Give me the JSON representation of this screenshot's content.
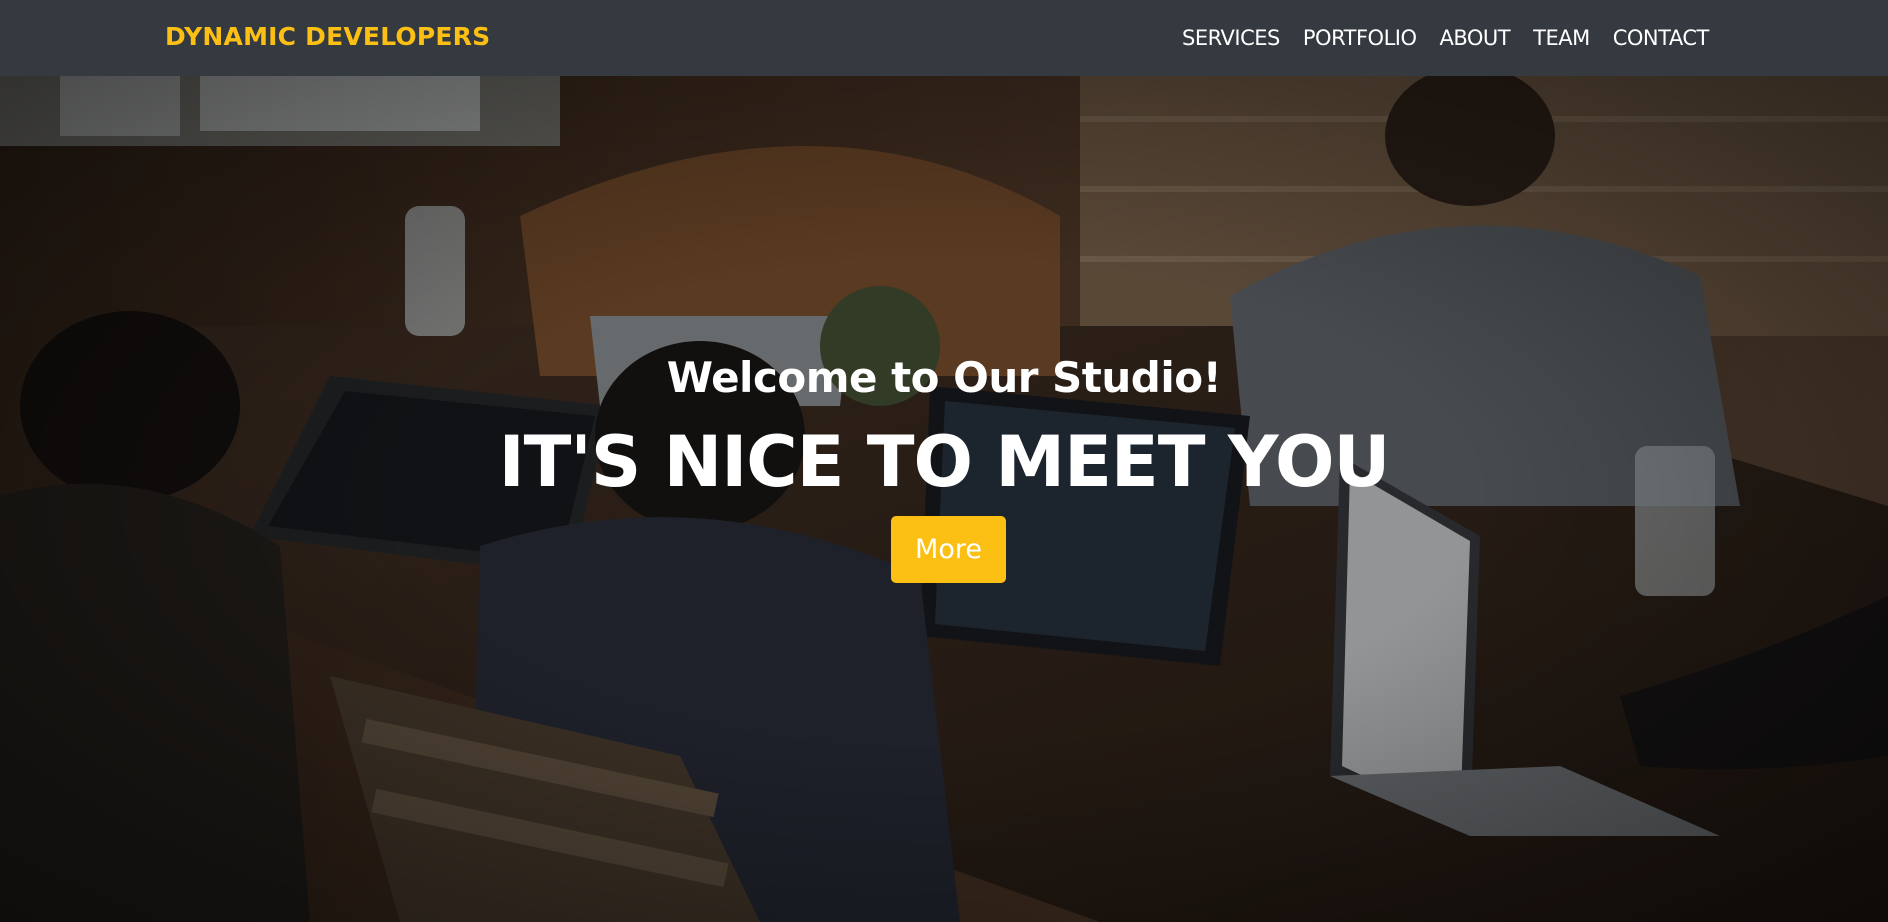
{
  "navbar": {
    "brand": "DYNAMIC DEVELOPERS",
    "links": [
      "SERVICES",
      "PORTFOLIO",
      "ABOUT",
      "TEAM",
      "CONTACT"
    ]
  },
  "hero": {
    "welcome": "Welcome to Our Studio!",
    "headline": "IT'S NICE TO MEET YOU",
    "button_label": "More",
    "background": "photo of a team working on laptops around a wooden table"
  },
  "colors": {
    "navbar_bg": "#343a40",
    "accent": "#fcc014",
    "text": "#ffffff"
  }
}
